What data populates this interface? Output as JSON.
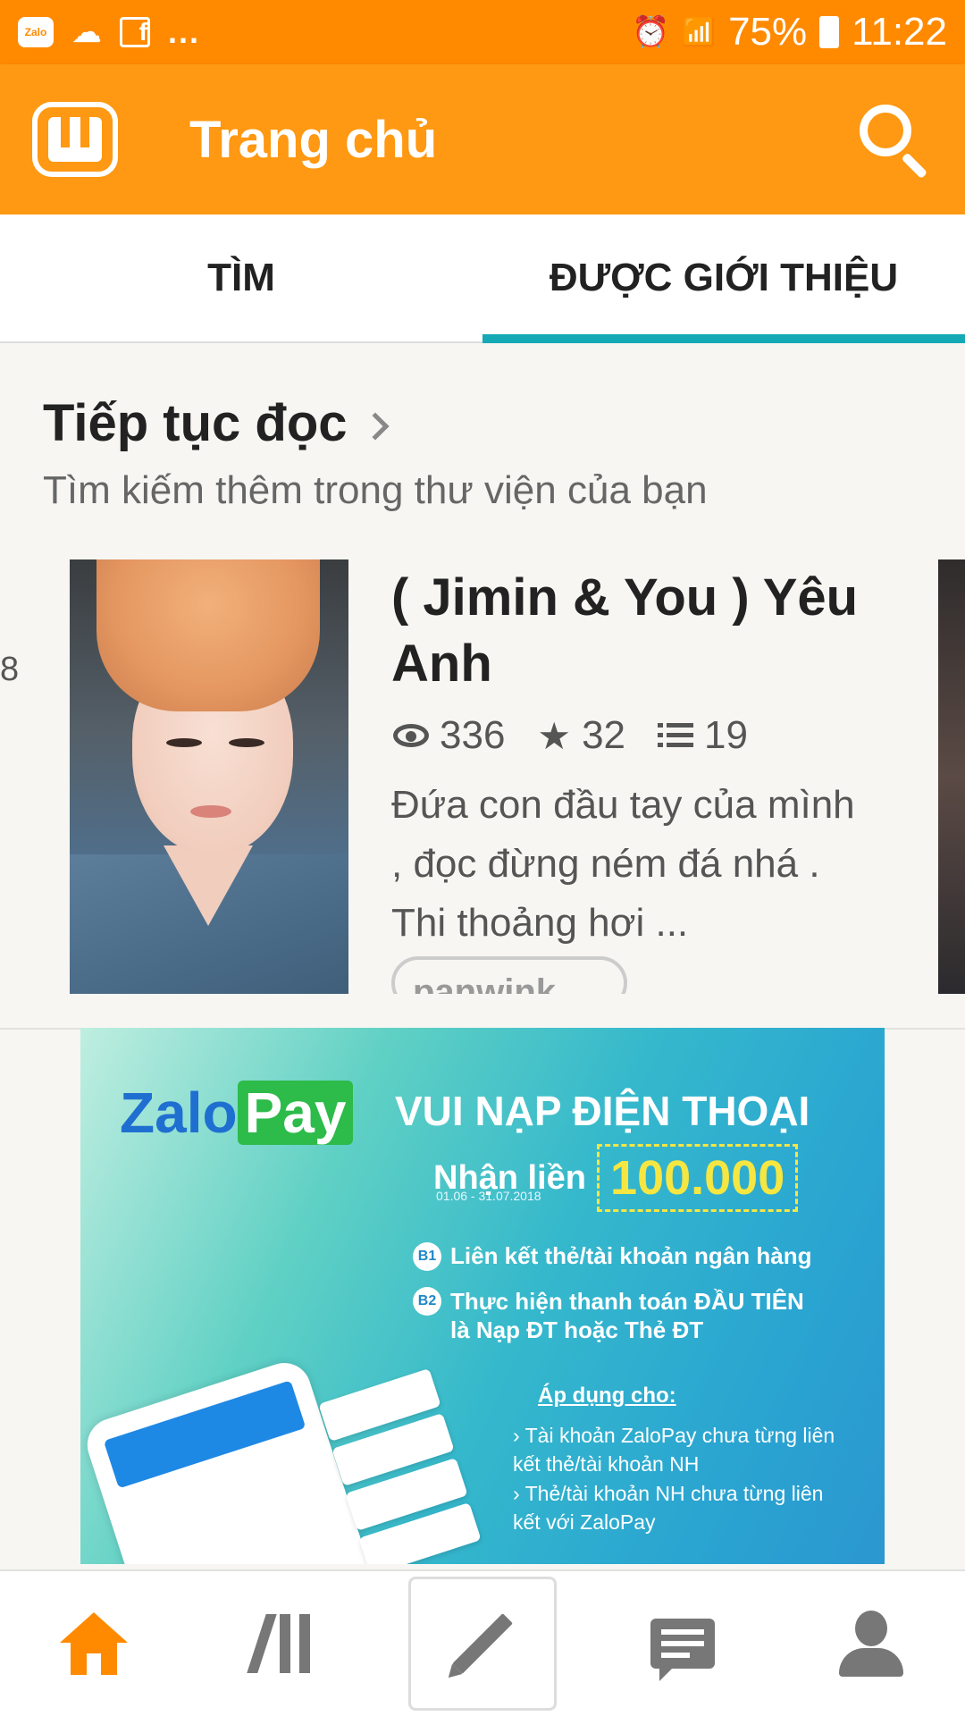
{
  "status_bar": {
    "zalo_label": "Zalo",
    "more": "...",
    "battery": "75%",
    "time": "11:22"
  },
  "header": {
    "title": "Trang chủ",
    "icons": [
      "wattpad-logo-icon",
      "search-icon"
    ]
  },
  "tabs": [
    {
      "label": "TÌM",
      "active": false
    },
    {
      "label": "ĐƯỢC GIỚI THIỆU",
      "active": true
    }
  ],
  "continue_reading": {
    "title": "Tiếp tục đọc",
    "subtitle": "Tìm kiếm thêm trong thư viện của bạn",
    "prev_card_edge": "8",
    "story": {
      "title": "( Jimin & You ) Yêu Anh",
      "views": "336",
      "votes": "32",
      "parts": "19",
      "description": "Đứa con đầu tay của mình , đọc đừng ném đá nhá . Thi thoảng hơi ...",
      "tag": "panwink"
    }
  },
  "ad": {
    "brand_a": "Zalo",
    "brand_b": "Pay",
    "headline": "VUI NẠP ĐIỆN THOẠI",
    "receive": "Nhận liền",
    "amount": "100.000",
    "date": "01.06 - 31.07.2018",
    "step1_num": "B1",
    "step1": "Liên kết thẻ/tài khoản ngân hàng",
    "step2_num": "B2",
    "step2": "Thực hiện thanh toán ĐẦU TIÊN là Nạp ĐT hoặc Thẻ ĐT",
    "apply": "Áp dụng cho:",
    "bullet1": "› Tài khoản ZaloPay chưa từng liên kết thẻ/tài khoản NH",
    "bullet2": "› Thẻ/tài khoản NH chưa từng liên kết với ZaloPay"
  },
  "bottom_nav": [
    {
      "icon": "home-icon",
      "active": true
    },
    {
      "icon": "library-icon",
      "active": false
    },
    {
      "icon": "pencil-icon",
      "active": false
    },
    {
      "icon": "message-icon",
      "active": false
    },
    {
      "icon": "profile-icon",
      "active": false
    }
  ],
  "colors": {
    "status_bar": "#ff8a00",
    "header": "#ff9812",
    "tab_indicator": "#14a9b5",
    "nav_active": "#ff8a00",
    "nav_inactive": "#777777"
  }
}
